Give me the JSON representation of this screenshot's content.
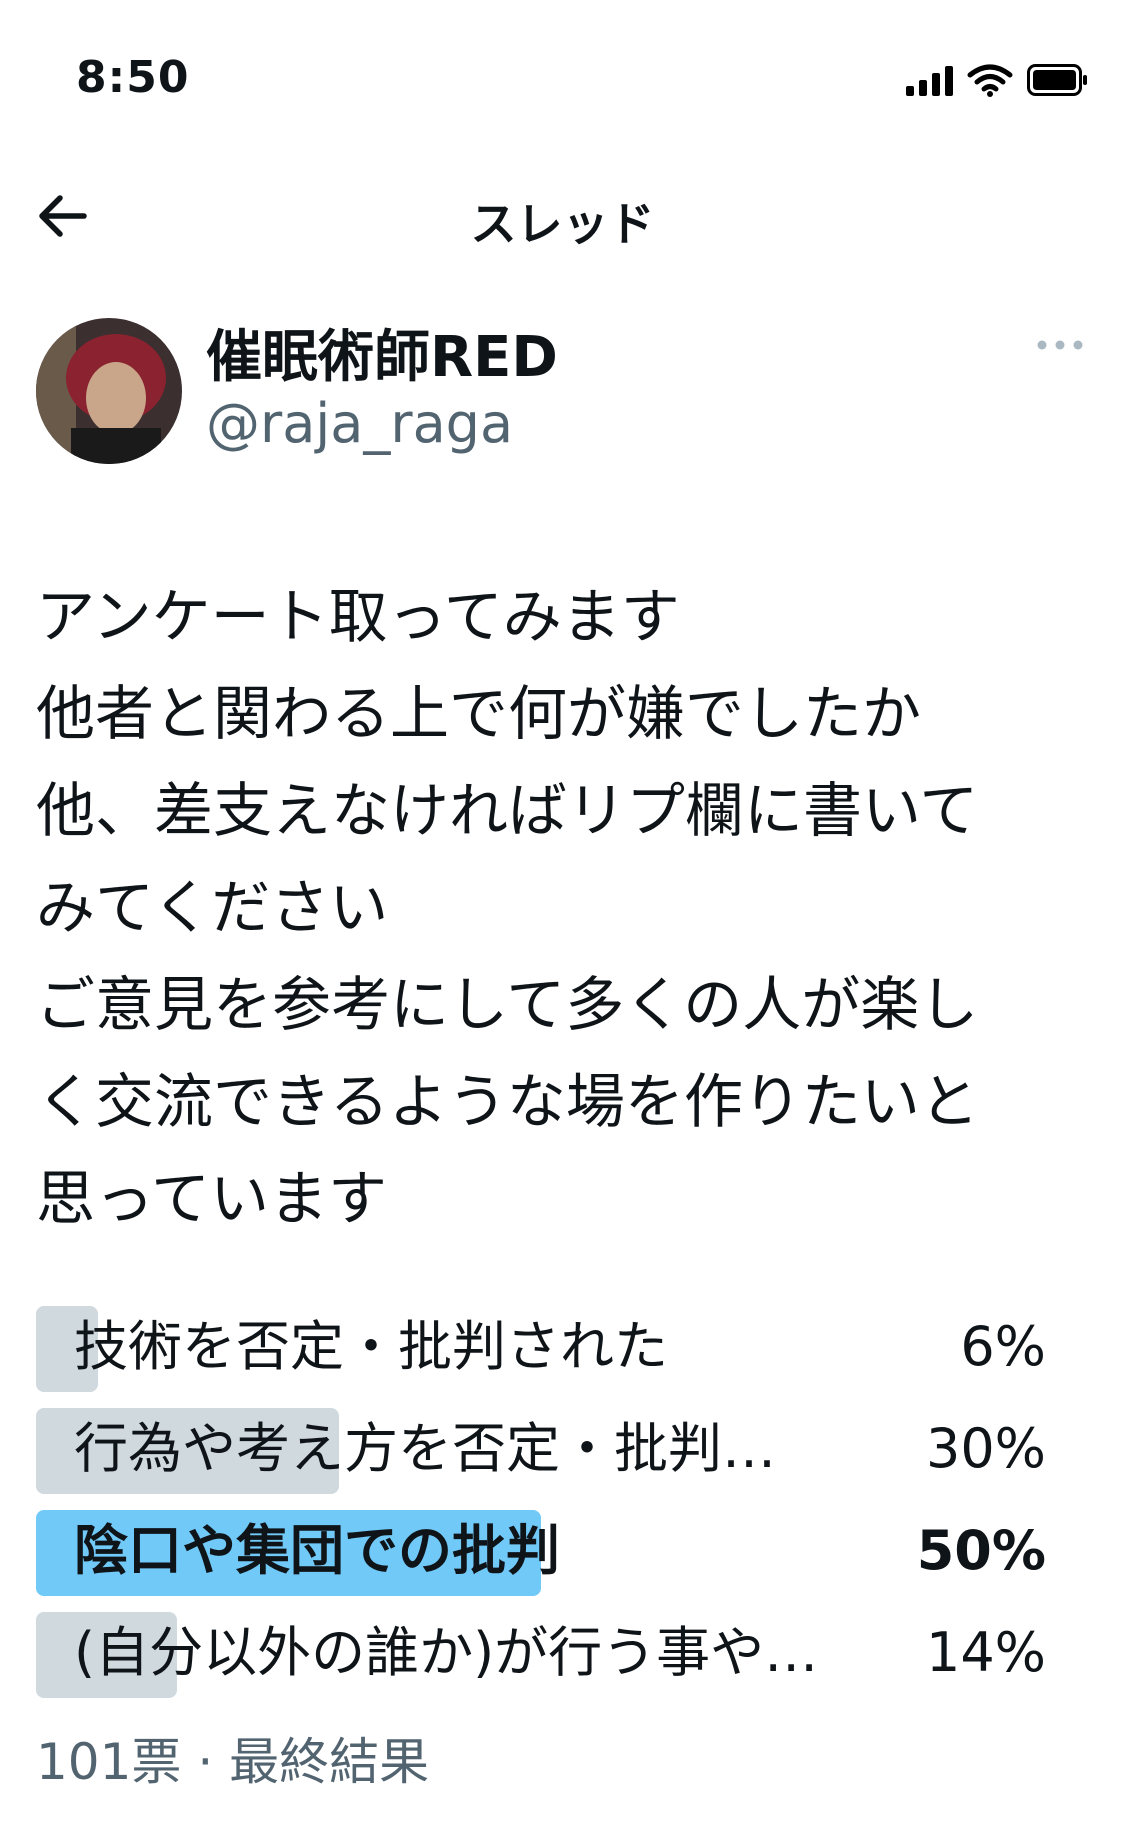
{
  "status_bar": {
    "time": "8:50"
  },
  "nav": {
    "title": "スレッド"
  },
  "author": {
    "display_name": "催眠術師RED",
    "handle": "@raja_raga"
  },
  "tweet": {
    "lines": [
      "アンケート取ってみます",
      "他者と関わる上で何が嫌でしたか",
      "他、差支えなければリプ欄に書いて",
      "みてください",
      "ご意見を参考にして多くの人が楽し",
      "く交流できるような場を作りたいと",
      "思っています"
    ]
  },
  "poll": {
    "options": [
      {
        "label": "技術を否定・批判された",
        "percent_text": "6%",
        "percent": 6,
        "winner": false
      },
      {
        "label": "行為や考え方を否定・批判…",
        "percent_text": "30%",
        "percent": 30,
        "winner": false
      },
      {
        "label": "陰口や集団での批判",
        "percent_text": "50%",
        "percent": 50,
        "winner": true
      },
      {
        "label": "(自分以外の誰か)が行う事や…",
        "percent_text": "14%",
        "percent": 14,
        "winner": false
      }
    ],
    "meta": "101票 · 最終結果"
  },
  "colors": {
    "winner_bar": "#71c9f8",
    "bar": "#cfd9de",
    "secondary_text": "#536471"
  },
  "icons": [
    "back-arrow-icon",
    "more-icon",
    "signal-icon",
    "wifi-icon",
    "battery-icon"
  ]
}
